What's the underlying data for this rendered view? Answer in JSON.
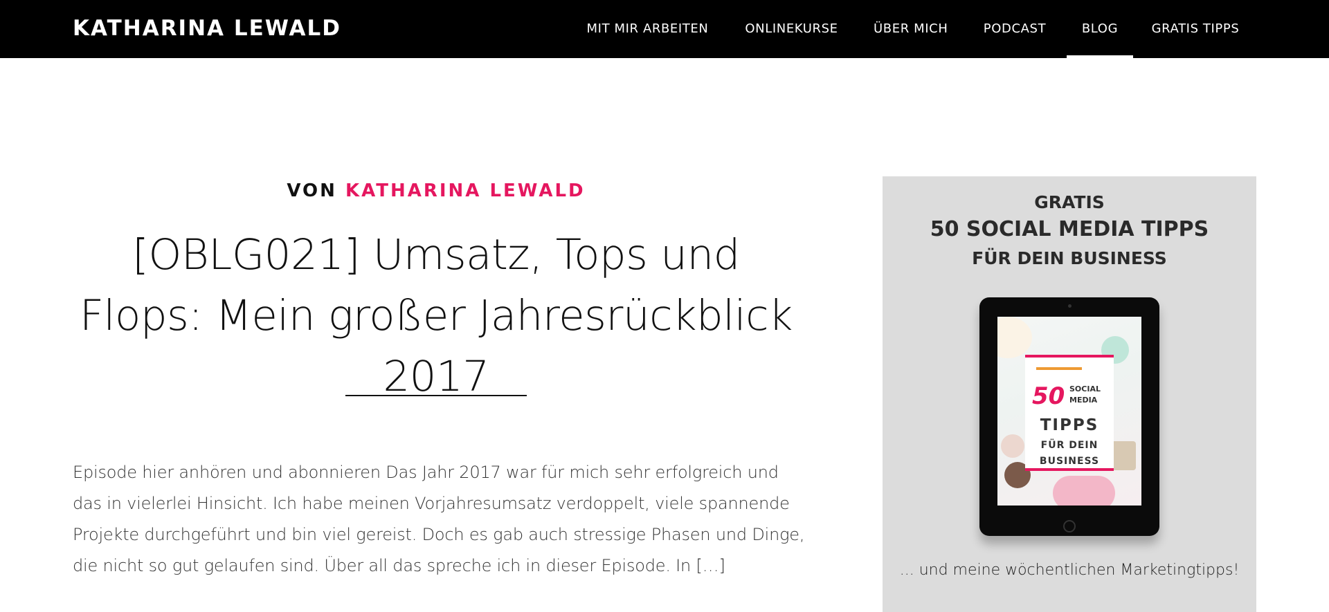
{
  "header": {
    "site_title": "KATHARINA LEWALD",
    "nav": [
      {
        "label": "MIT MIR ARBEITEN",
        "active": false
      },
      {
        "label": "ONLINEKURSE",
        "active": false
      },
      {
        "label": "ÜBER MICH",
        "active": false
      },
      {
        "label": "PODCAST",
        "active": false
      },
      {
        "label": "BLOG",
        "active": true
      },
      {
        "label": "GRATIS TIPPS",
        "active": false
      }
    ]
  },
  "post": {
    "byline_prefix": "VON",
    "author": "KATHARINA LEWALD",
    "title": "[OBLG021] Umsatz, Tops und Flops: Mein großer Jahresrückblick 2017",
    "excerpt": "Episode hier anhören und abonnieren Das Jahr 2017 war für mich sehr erfolgreich und das in vielerlei Hinsicht. Ich habe meinen Vorjahresumsatz verdoppelt, viele spannende Projekte durchgeführt und bin viel gereist. Doch es gab auch stressige Phasen und Dinge, die nicht so gut gelaufen sind. Über all das spreche ich in dieser Episode. In […]"
  },
  "sidebar": {
    "line1": "GRATIS",
    "line2": "50 SOCIAL MEDIA TIPPS",
    "line3": "FÜR DEIN BUSINESS",
    "cover": {
      "number": "50",
      "social": "SOCIAL",
      "media": "MEDIA",
      "tipps": "TIPPS",
      "fuer_dein": "FÜR DEIN",
      "business": "BUSINESS"
    },
    "caption": "... und meine wöchentlichen Marketingtipps!"
  },
  "colors": {
    "accent": "#e5175f",
    "header_bg": "#000000",
    "widget_bg": "#dcdcdc",
    "cover_orange": "#ee9a33"
  }
}
